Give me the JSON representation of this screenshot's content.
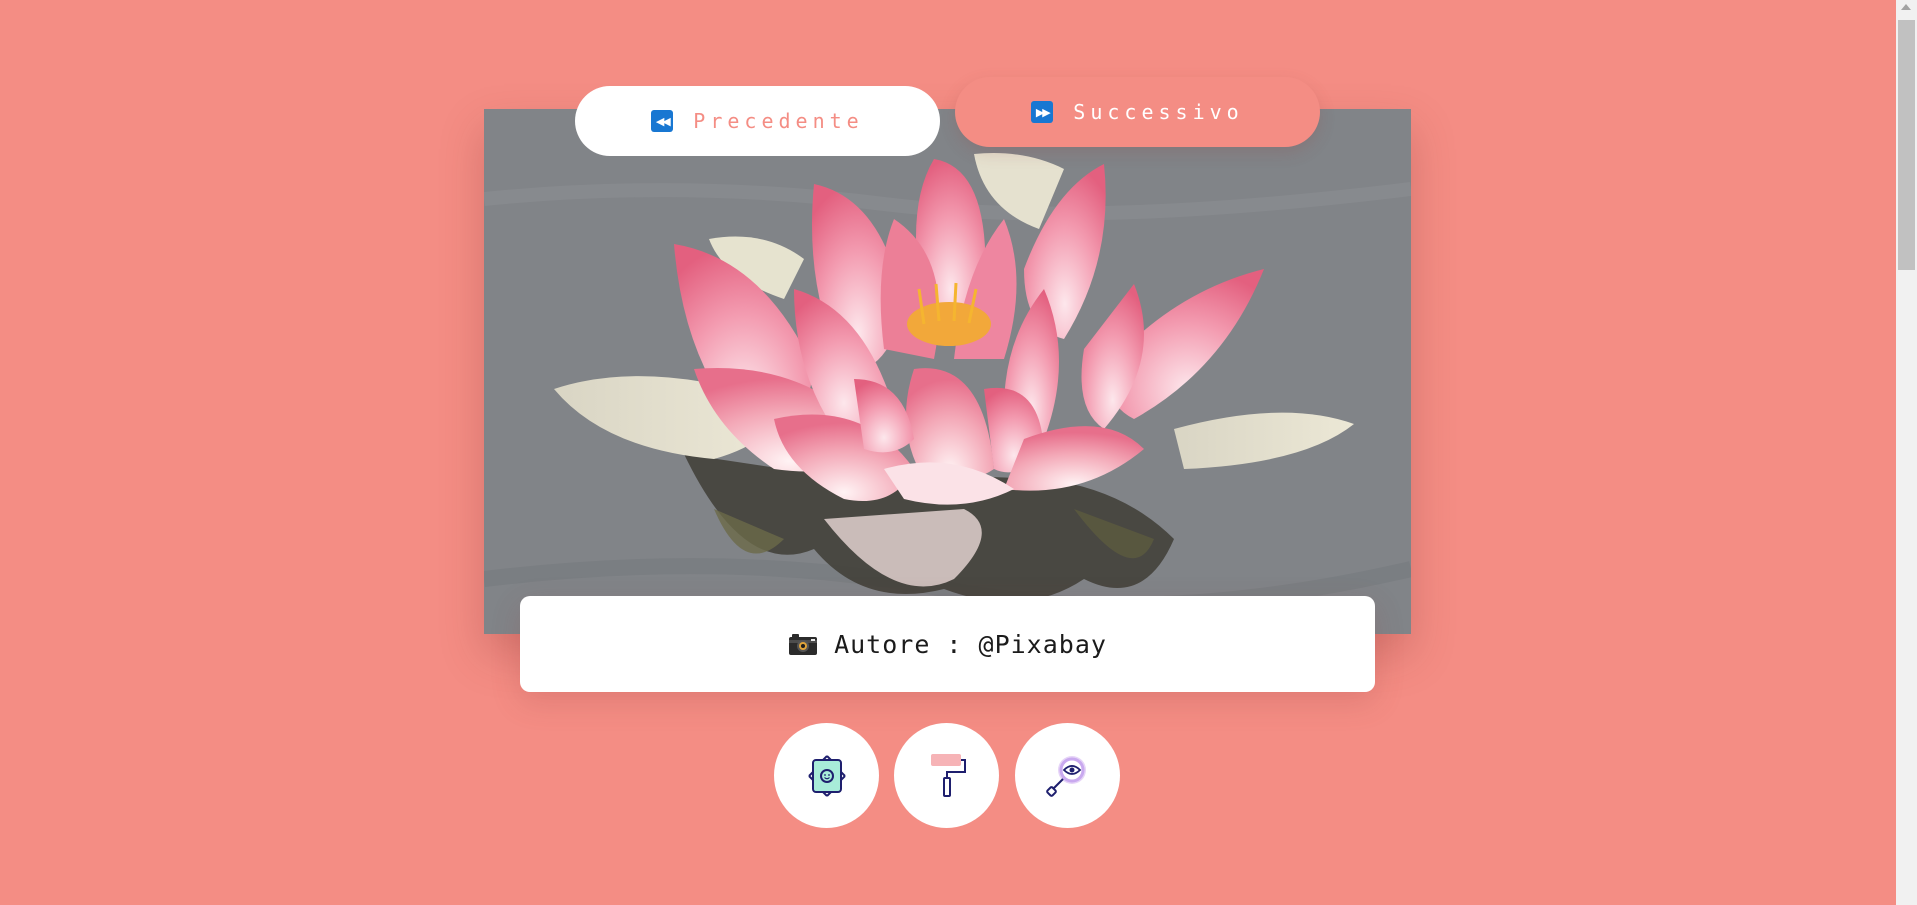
{
  "navigation": {
    "prev_label": "Precedente",
    "prev_icon": "rewind-icon",
    "next_label": "Successivo",
    "next_icon": "fast-forward-icon"
  },
  "photo": {
    "subject": "pink water lily"
  },
  "author_card": {
    "icon": "camera-icon",
    "text": "Autore : @Pixabay"
  },
  "tools": [
    {
      "name": "photo-frame-icon"
    },
    {
      "name": "paint-roller-icon"
    },
    {
      "name": "magnifier-eye-icon"
    }
  ],
  "colors": {
    "background": "#f48d84",
    "accent_blue": "#1877d2",
    "icon_navy": "#1e1f6e"
  }
}
